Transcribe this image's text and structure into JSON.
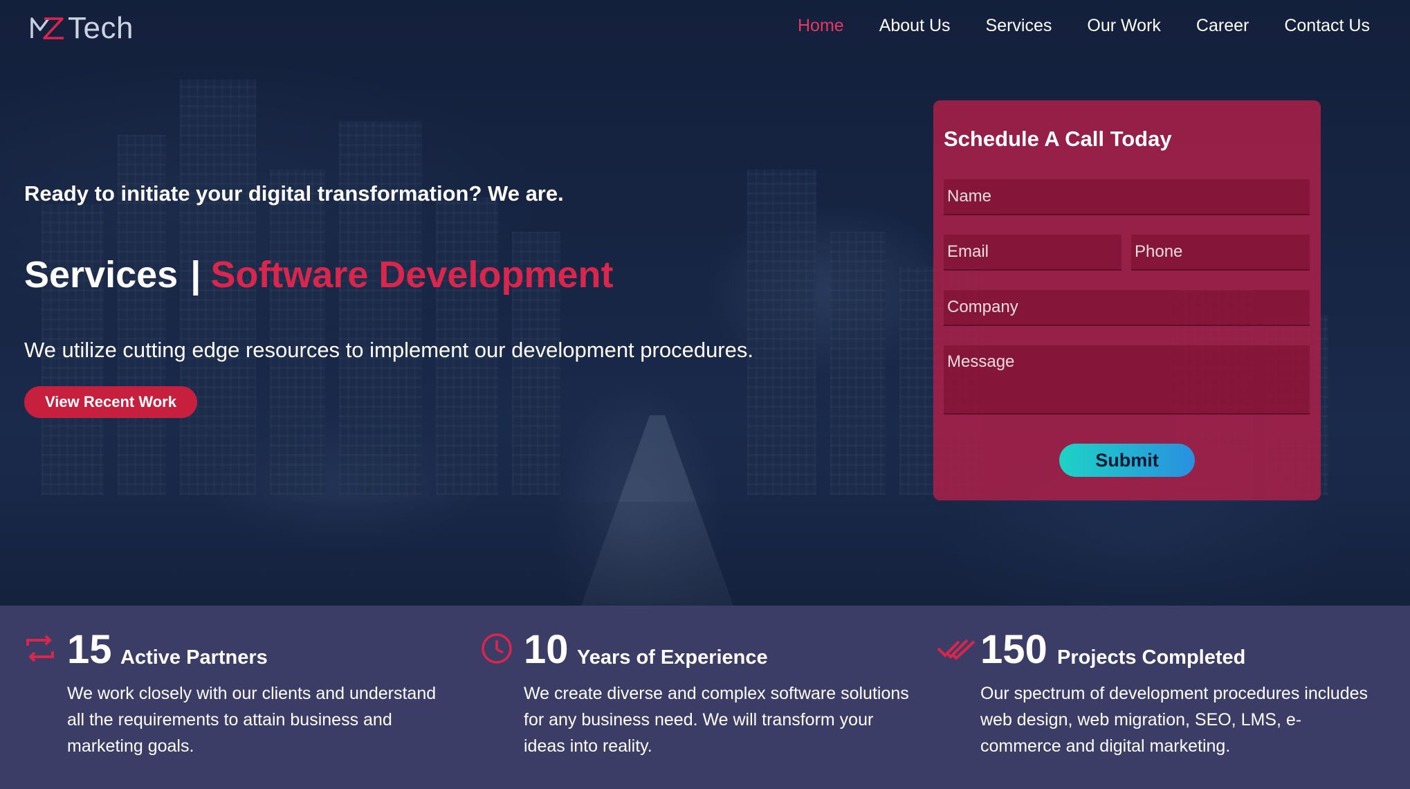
{
  "brand": {
    "logo_text": "Tech",
    "logo_mark": "MZ"
  },
  "nav": {
    "items": [
      {
        "label": "Home",
        "active": true
      },
      {
        "label": "About Us"
      },
      {
        "label": "Services"
      },
      {
        "label": "Our Work"
      },
      {
        "label": "Career"
      },
      {
        "label": "Contact Us"
      }
    ]
  },
  "hero": {
    "tagline": "Ready to initiate your digital transformation? We are.",
    "heading_main": "Services",
    "heading_separator": "|",
    "heading_accent": "Software Development",
    "subtext": "We utilize cutting edge resources to implement our development procedures.",
    "cta_label": "View Recent Work"
  },
  "form": {
    "title": "Schedule A Call Today",
    "name_placeholder": "Name",
    "email_placeholder": "Email",
    "phone_placeholder": "Phone",
    "company_placeholder": "Company",
    "message_placeholder": "Message",
    "submit_label": "Submit"
  },
  "stats": [
    {
      "icon": "repeat-icon",
      "number": "15",
      "label": "Active Partners",
      "description": "We work closely with our clients and understand all the requirements to attain business and marketing goals."
    },
    {
      "icon": "clock-icon",
      "number": "10",
      "label": "Years of Experience",
      "description": "We create diverse and complex software solutions for any business need. We will transform your ideas into reality."
    },
    {
      "icon": "double-check-icon",
      "number": "150",
      "label": "Projects Completed",
      "description": "Our spectrum of development procedures includes web design, web migration, SEO, LMS, e-commerce and digital marketing."
    }
  ],
  "colors": {
    "accent": "#d8264d",
    "nav_active": "#e23a62",
    "form_bg": "#ab2048",
    "stats_bg": "#3b3d67",
    "submit_gradient_start": "#1dd3c4",
    "submit_gradient_end": "#2a8fe0"
  }
}
